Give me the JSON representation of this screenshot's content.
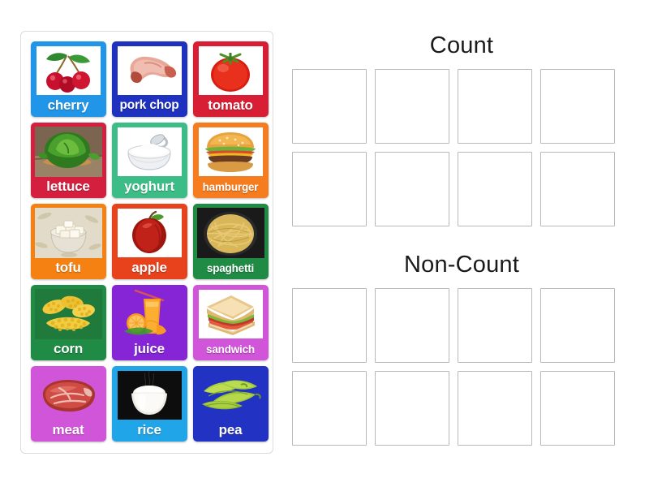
{
  "activity": {
    "type": "drag-and-drop-group-sort",
    "background_color": "#ffffff"
  },
  "source_panel": {
    "name": "word-tile-bank",
    "border_color": "#dcdcdc",
    "columns": 3,
    "rows": 5,
    "tiles": [
      {
        "label": "cherry",
        "color": "#2196e8",
        "image": "cherries-photo",
        "label_size": "normal",
        "photo_style": "inset-white"
      },
      {
        "label": "pork chop",
        "color": "#1f31bf",
        "image": "pork-chop-photo",
        "label_size": "medium",
        "photo_style": "inset-white"
      },
      {
        "label": "tomato",
        "color": "#d81e34",
        "image": "tomato-photo",
        "label_size": "normal",
        "photo_style": "inset-white"
      },
      {
        "label": "lettuce",
        "color": "#d51f3f",
        "image": "lettuce-photo",
        "label_size": "normal",
        "photo_style": "full-bleed"
      },
      {
        "label": "yoghurt",
        "color": "#3cbd87",
        "image": "yoghurt-bowl-photo",
        "label_size": "normal",
        "photo_style": "inset-white"
      },
      {
        "label": "hamburger",
        "color": "#f57c1f",
        "image": "hamburger-photo",
        "label_size": "small",
        "photo_style": "inset-white"
      },
      {
        "label": "tofu",
        "color": "#f58113",
        "image": "tofu-bowl-photo",
        "label_size": "normal",
        "photo_style": "full-bleed"
      },
      {
        "label": "apple",
        "color": "#e8421c",
        "image": "red-apple-photo",
        "label_size": "normal",
        "photo_style": "inset-white"
      },
      {
        "label": "spaghetti",
        "color": "#1f8b45",
        "image": "spaghetti-photo",
        "label_size": "small",
        "photo_style": "full-bleed"
      },
      {
        "label": "corn",
        "color": "#1f8b45",
        "image": "corn-photo",
        "label_size": "normal",
        "photo_style": "full-bleed"
      },
      {
        "label": "juice",
        "color": "#8625d6",
        "image": "orange-juice-photo",
        "label_size": "normal",
        "photo_style": "full-bleed"
      },
      {
        "label": "sandwich",
        "color": "#d155d8",
        "image": "sandwich-photo",
        "label_size": "small",
        "photo_style": "inset-white"
      },
      {
        "label": "meat",
        "color": "#d155d8",
        "image": "raw-steak-photo",
        "label_size": "normal",
        "photo_style": "full-bleed"
      },
      {
        "label": "rice",
        "color": "#20a6e8",
        "image": "rice-bowl-photo",
        "label_size": "normal",
        "photo_style": "inset-dark"
      },
      {
        "label": "pea",
        "color": "#2233c4",
        "image": "pea-pods-photo",
        "label_size": "normal",
        "photo_style": "full-bleed"
      }
    ]
  },
  "groups": [
    {
      "name": "count",
      "title": "Count",
      "slot_count": 8,
      "slots": [
        "",
        "",
        "",
        "",
        "",
        "",
        "",
        ""
      ]
    },
    {
      "name": "non-count",
      "title": "Non-Count",
      "slot_count": 8,
      "slots": [
        "",
        "",
        "",
        "",
        "",
        "",
        "",
        ""
      ]
    }
  ]
}
